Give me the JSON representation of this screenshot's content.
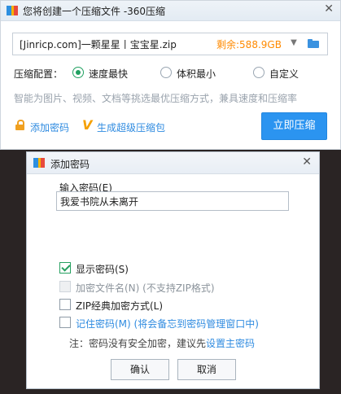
{
  "main_window": {
    "title": "您将创建一个压缩文件 -360压缩",
    "close_label": "✕",
    "path_value": "[Jinricp.com]一颗星星丨宝宝星.zip",
    "remaining_space": "剩余:588.9GB",
    "config_label": "压缩配置：",
    "options": [
      {
        "label": "速度最快",
        "selected": true
      },
      {
        "label": "体积最小",
        "selected": false
      },
      {
        "label": "自定义",
        "selected": false
      }
    ],
    "hint": "智能为图片、视频、文档等挑选最优压缩方式，兼具速度和压缩率",
    "add_password_label": "添加密码",
    "super_package_label": "生成超级压缩包",
    "compress_button": "立即压缩"
  },
  "password_dialog": {
    "title": "添加密码",
    "close_label": "✕",
    "input_label": "输入密码(E)",
    "password_value": "我爱书院从未离开",
    "checkboxes": [
      {
        "label": "显示密码(S)",
        "checked": true,
        "disabled": false
      },
      {
        "label": "加密文件名(N) (不支持ZIP格式)",
        "checked": false,
        "disabled": true
      },
      {
        "label": "ZIP经典加密方式(L)",
        "checked": false,
        "disabled": false
      },
      {
        "label": "记住密码(M) (将会备忘到密码管理窗口中)",
        "checked": false,
        "disabled": false
      }
    ],
    "note_prefix": "注：密码没有安全加密，建议先",
    "note_link": "设置主密码",
    "ok_button": "确认",
    "cancel_button": "取消"
  },
  "colors": {
    "accent": "#2b94f0",
    "link": "#2f8be0",
    "orange": "#ff8a00",
    "check_green": "#26a060"
  }
}
